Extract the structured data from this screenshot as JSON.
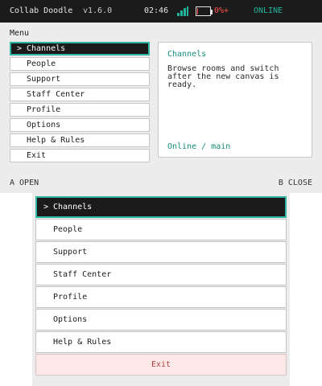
{
  "status_bar": {
    "app_name": "Collab Doodle",
    "version": "v1.6.0",
    "time": "02:46",
    "signal_icon": "signal-bars-icon",
    "battery_icon": "battery-icon",
    "battery_text": "0%+",
    "battery_level": 0.05,
    "connection_status": "ONLINE"
  },
  "colors": {
    "accent": "#2fb5a0",
    "accent_text": "#148a7a",
    "bar_bg": "#1b1b1b",
    "battery_low": "#ff5050",
    "exit_bg": "#fde8e8",
    "exit_text": "#b24040"
  },
  "top_screen": {
    "menu_label": "Menu",
    "selected_caret": ">",
    "items": [
      {
        "label": "Channels",
        "selected": true
      },
      {
        "label": "People",
        "selected": false
      },
      {
        "label": "Support",
        "selected": false
      },
      {
        "label": "Staff Center",
        "selected": false
      },
      {
        "label": "Profile",
        "selected": false
      },
      {
        "label": "Options",
        "selected": false
      },
      {
        "label": "Help & Rules",
        "selected": false
      },
      {
        "label": "Exit",
        "selected": false
      }
    ],
    "info_panel": {
      "title": "Channels",
      "description": "Browse rooms and switch after the new canvas is ready.",
      "footer": "Online / main"
    },
    "hints": {
      "left": "A OPEN",
      "right": "B CLOSE"
    }
  },
  "bottom_screen": {
    "selected_caret": ">",
    "items": [
      {
        "label": "Channels",
        "selected": true
      },
      {
        "label": "People",
        "selected": false
      },
      {
        "label": "Support",
        "selected": false
      },
      {
        "label": "Staff Center",
        "selected": false
      },
      {
        "label": "Profile",
        "selected": false
      },
      {
        "label": "Options",
        "selected": false
      },
      {
        "label": "Help & Rules",
        "selected": false
      },
      {
        "label": "Exit",
        "selected": false,
        "variant": "exit"
      }
    ]
  }
}
